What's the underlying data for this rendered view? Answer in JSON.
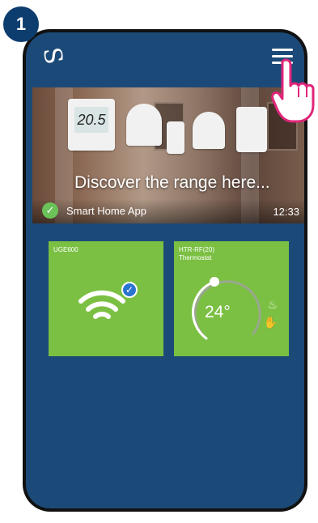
{
  "step": {
    "number": "1"
  },
  "app": {
    "logo_glyph": "S"
  },
  "banner": {
    "title": "Discover the range here...",
    "thermostat_display": "20.5",
    "app_label": "Smart Home App",
    "time": "12:33"
  },
  "devices": [
    {
      "name": "UGE600",
      "subtitle": "",
      "icon": "wifi-icon",
      "connected": true
    },
    {
      "name": "HTR-RF(20)",
      "subtitle": "Thermostat",
      "temperature": "24°",
      "icons": [
        "heat-icon",
        "hand-icon"
      ]
    }
  ],
  "colors": {
    "background": "#1c4a78",
    "tile": "#7bc043",
    "badge": "#0d3d6e",
    "pointer": "#e0267a"
  }
}
